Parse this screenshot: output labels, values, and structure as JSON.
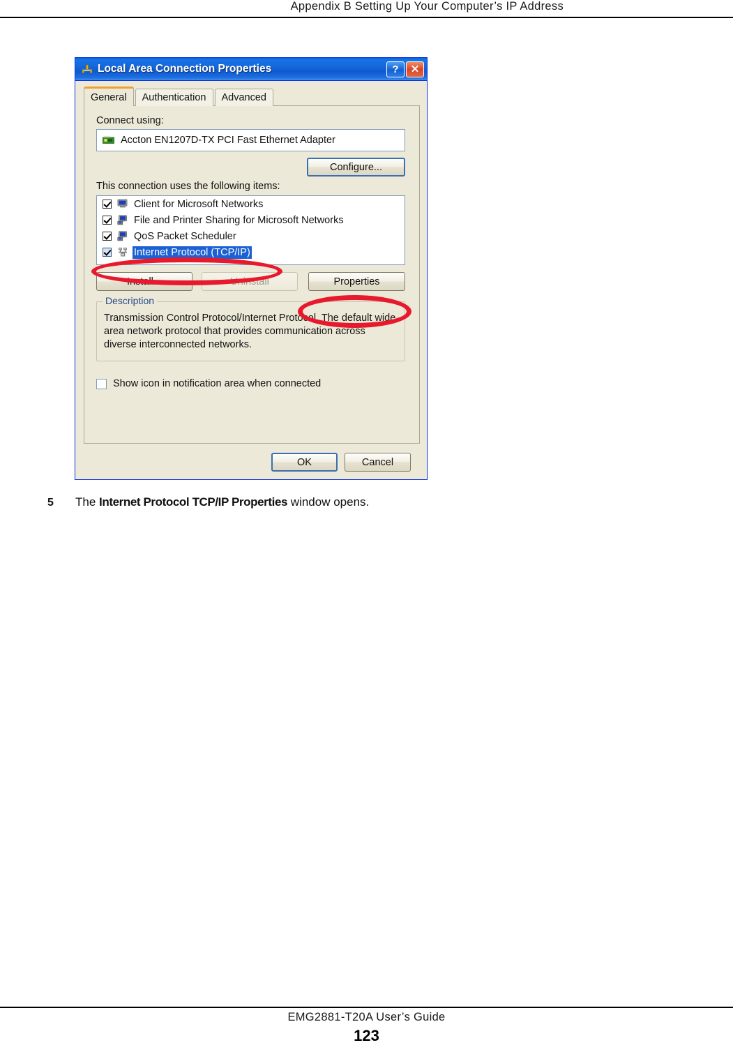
{
  "page": {
    "header": "Appendix B Setting Up Your Computer’s IP Address",
    "footer_title": "EMG2881-T20A User’s Guide",
    "page_number": "123"
  },
  "step": {
    "number": "5",
    "text_before": "The ",
    "emphasis": "Internet Protocol TCP/IP Properties",
    "text_after": " window opens."
  },
  "dialog": {
    "title": "Local Area Connection Properties",
    "titlebar_icon": "network-connection-icon",
    "help_button": "?",
    "close_button": "✕",
    "tabs": [
      {
        "label": "General",
        "active": true
      },
      {
        "label": "Authentication",
        "active": false
      },
      {
        "label": "Advanced",
        "active": false
      }
    ],
    "connect_using_label": "Connect using:",
    "adapter": {
      "icon": "network-adapter-card-icon",
      "name": "Accton EN1207D-TX PCI Fast Ethernet Adapter"
    },
    "configure_button": "Configure...",
    "items_label": "This connection uses the following items:",
    "items": [
      {
        "label": "Client for Microsoft Networks",
        "checked": true,
        "selected": false,
        "icon": "client-computer-icon"
      },
      {
        "label": "File and Printer Sharing for Microsoft Networks",
        "checked": true,
        "selected": false,
        "icon": "file-printer-sharing-icon"
      },
      {
        "label": "QoS Packet Scheduler",
        "checked": true,
        "selected": false,
        "icon": "qos-scheduler-icon"
      },
      {
        "label": "Internet Protocol (TCP/IP)",
        "checked": true,
        "selected": true,
        "icon": "tcpip-protocol-icon"
      }
    ],
    "install_button": "Install...",
    "uninstall_button": "Uninstall",
    "properties_button": "Properties",
    "description_legend": "Description",
    "description_text": "Transmission Control Protocol/Internet Protocol. The default wide area network protocol that provides communication across diverse interconnected networks.",
    "notify_checkbox_label": "Show icon in notification area when connected",
    "notify_checked": false,
    "ok_button": "OK",
    "cancel_button": "Cancel"
  },
  "annotations": [
    {
      "name": "highlight-tcpip-item",
      "shape": "ellipse",
      "color": "#e8192c",
      "target": "Internet Protocol (TCP/IP)"
    },
    {
      "name": "highlight-properties-button",
      "shape": "ellipse",
      "color": "#e8192c",
      "target": "Properties"
    }
  ],
  "colors": {
    "annotation_red": "#e8192c",
    "dialog_face": "#ece9d8",
    "titlebar_blue": "#1668da",
    "selection_blue": "#1c61d4",
    "tab_accent_orange": "#f0a030"
  }
}
